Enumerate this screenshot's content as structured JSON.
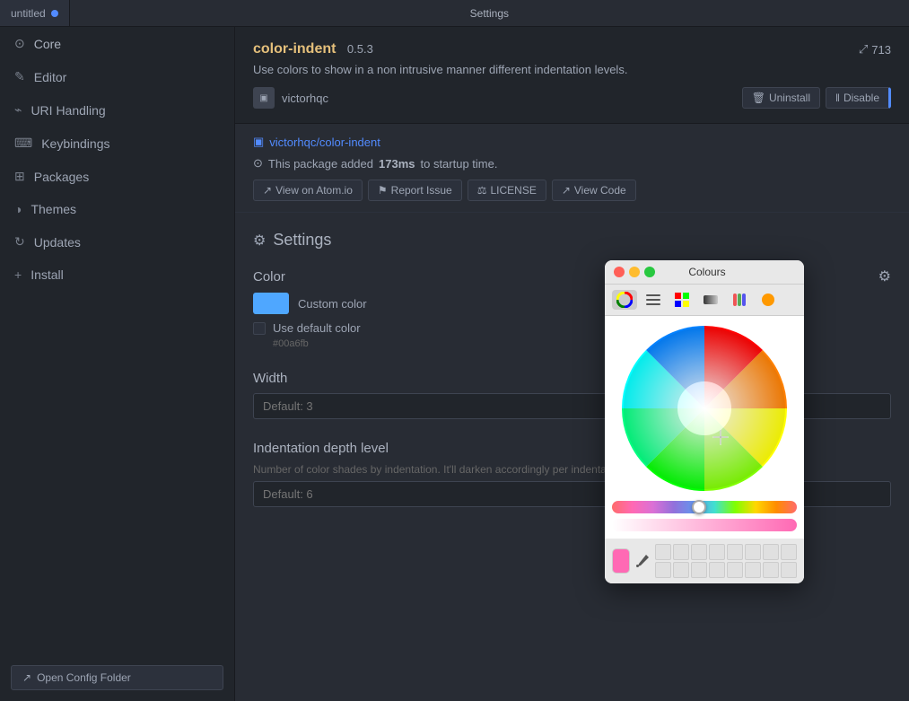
{
  "tab": {
    "title": "untitled",
    "dot_visible": true,
    "settings_label": "Settings"
  },
  "sidebar": {
    "items": [
      {
        "id": "core",
        "label": "Core",
        "icon": "⊙"
      },
      {
        "id": "editor",
        "label": "Editor",
        "icon": "✎"
      },
      {
        "id": "uri-handling",
        "label": "URI Handling",
        "icon": "⌁"
      },
      {
        "id": "keybindings",
        "label": "Keybindings",
        "icon": "⌨"
      },
      {
        "id": "packages",
        "label": "Packages",
        "icon": "⊞"
      },
      {
        "id": "themes",
        "label": "Themes",
        "icon": "◑"
      },
      {
        "id": "updates",
        "label": "Updates",
        "icon": "↻"
      },
      {
        "id": "install",
        "label": "Install",
        "icon": "+"
      }
    ],
    "open_config_btn": "Open Config Folder"
  },
  "package": {
    "name": "color-indent",
    "version": "0.5.3",
    "stars": "713",
    "description": "Use colors to show in a non intrusive manner different indentation levels.",
    "author": "victorhqc",
    "uninstall_label": "Uninstall",
    "disable_label": "Disable",
    "meta_link": "victorhqc/color-indent",
    "startup_prefix": "This package added",
    "startup_time": "173ms",
    "startup_suffix": "to startup time.",
    "view_on_atomio": "View on Atom.io",
    "report_issue": "Report Issue",
    "license": "LICENSE",
    "view_code": "View Code"
  },
  "settings": {
    "title": "Settings",
    "color_label": "Color",
    "adjust_icon": "⚙",
    "color_custom_label": "Custom color",
    "use_default_label": "Use default color",
    "hex_value": "#00a6fb",
    "width_label": "Width",
    "width_placeholder": "Default: 3",
    "depth_label": "Indentation depth level",
    "depth_desc": "Number of color shades by indentation. It'll darken accordingly per indentation.",
    "depth_placeholder": "Default: 6"
  },
  "color_picker": {
    "title": "Colours",
    "tab_icons": [
      "🎨",
      "▦",
      "⊞",
      "▬",
      "▤",
      "🟠"
    ]
  }
}
